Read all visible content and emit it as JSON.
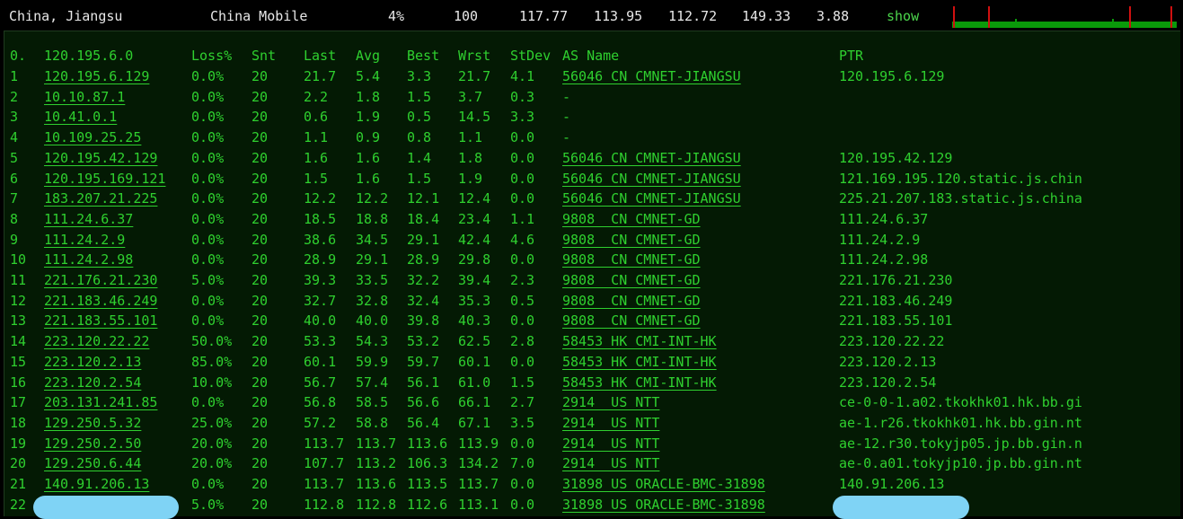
{
  "summary": {
    "location": "China, Jiangsu",
    "provider": "China Mobile",
    "loss": "4%",
    "sent": "100",
    "last": "117.77",
    "avg": "113.95",
    "best": "112.72",
    "worst": "149.33",
    "stdev": "3.88",
    "show_label": "show"
  },
  "colors": {
    "text_green": "#2fd02f",
    "panel_bg": "#041a04",
    "spark_green": "#0a9a0a",
    "spark_red": "#d01010",
    "redact_blue": "#7fd3f5"
  },
  "headers": {
    "hop": "0.",
    "host": "120.195.6.0",
    "loss": "Loss%",
    "snt": "Snt",
    "last": "Last",
    "avg": "Avg",
    "best": "Best",
    "wrst": "Wrst",
    "stdev": "StDev",
    "asname": "AS Name",
    "ptr": "PTR"
  },
  "hops": [
    {
      "hop": "1",
      "host": "120.195.6.129",
      "loss": "0.0%",
      "snt": "20",
      "last": "21.7",
      "avg": "5.4",
      "best": "3.3",
      "wrst": "21.7",
      "stdev": "4.1",
      "asname": "56046 CN CMNET-JIANGSU",
      "ptr": "120.195.6.129"
    },
    {
      "hop": "2",
      "host": "10.10.87.1",
      "loss": "0.0%",
      "snt": "20",
      "last": "2.2",
      "avg": "1.8",
      "best": "1.5",
      "wrst": "3.7",
      "stdev": "0.3",
      "asname": "-",
      "ptr": ""
    },
    {
      "hop": "3",
      "host": "10.41.0.1",
      "loss": "0.0%",
      "snt": "20",
      "last": "0.6",
      "avg": "1.9",
      "best": "0.5",
      "wrst": "14.5",
      "stdev": "3.3",
      "asname": "-",
      "ptr": ""
    },
    {
      "hop": "4",
      "host": "10.109.25.25",
      "loss": "0.0%",
      "snt": "20",
      "last": "1.1",
      "avg": "0.9",
      "best": "0.8",
      "wrst": "1.1",
      "stdev": "0.0",
      "asname": "-",
      "ptr": ""
    },
    {
      "hop": "5",
      "host": "120.195.42.129",
      "loss": "0.0%",
      "snt": "20",
      "last": "1.6",
      "avg": "1.6",
      "best": "1.4",
      "wrst": "1.8",
      "stdev": "0.0",
      "asname": "56046 CN CMNET-JIANGSU",
      "ptr": "120.195.42.129"
    },
    {
      "hop": "6",
      "host": "120.195.169.121",
      "loss": "0.0%",
      "snt": "20",
      "last": "1.5",
      "avg": "1.6",
      "best": "1.5",
      "wrst": "1.9",
      "stdev": "0.0",
      "asname": "56046 CN CMNET-JIANGSU",
      "ptr": "121.169.195.120.static.js.chin"
    },
    {
      "hop": "7",
      "host": "183.207.21.225",
      "loss": "0.0%",
      "snt": "20",
      "last": "12.2",
      "avg": "12.2",
      "best": "12.1",
      "wrst": "12.4",
      "stdev": "0.0",
      "asname": "56046 CN CMNET-JIANGSU",
      "ptr": "225.21.207.183.static.js.china"
    },
    {
      "hop": "8",
      "host": "111.24.6.37",
      "loss": "0.0%",
      "snt": "20",
      "last": "18.5",
      "avg": "18.8",
      "best": "18.4",
      "wrst": "23.4",
      "stdev": "1.1",
      "asname": "9808  CN CMNET-GD",
      "ptr": "111.24.6.37"
    },
    {
      "hop": "9",
      "host": "111.24.2.9",
      "loss": "0.0%",
      "snt": "20",
      "last": "38.6",
      "avg": "34.5",
      "best": "29.1",
      "wrst": "42.4",
      "stdev": "4.6",
      "asname": "9808  CN CMNET-GD",
      "ptr": "111.24.2.9"
    },
    {
      "hop": "10",
      "host": "111.24.2.98",
      "loss": "0.0%",
      "snt": "20",
      "last": "28.9",
      "avg": "29.1",
      "best": "28.9",
      "wrst": "29.8",
      "stdev": "0.0",
      "asname": "9808  CN CMNET-GD",
      "ptr": "111.24.2.98"
    },
    {
      "hop": "11",
      "host": "221.176.21.230",
      "loss": "5.0%",
      "snt": "20",
      "last": "39.3",
      "avg": "33.5",
      "best": "32.2",
      "wrst": "39.4",
      "stdev": "2.3",
      "asname": "9808  CN CMNET-GD",
      "ptr": "221.176.21.230"
    },
    {
      "hop": "12",
      "host": "221.183.46.249",
      "loss": "0.0%",
      "snt": "20",
      "last": "32.7",
      "avg": "32.8",
      "best": "32.4",
      "wrst": "35.3",
      "stdev": "0.5",
      "asname": "9808  CN CMNET-GD",
      "ptr": "221.183.46.249"
    },
    {
      "hop": "13",
      "host": "221.183.55.101",
      "loss": "0.0%",
      "snt": "20",
      "last": "40.0",
      "avg": "40.0",
      "best": "39.8",
      "wrst": "40.3",
      "stdev": "0.0",
      "asname": "9808  CN CMNET-GD",
      "ptr": "221.183.55.101"
    },
    {
      "hop": "14",
      "host": "223.120.22.22",
      "loss": "50.0%",
      "snt": "20",
      "last": "53.3",
      "avg": "54.3",
      "best": "53.2",
      "wrst": "62.5",
      "stdev": "2.8",
      "asname": "58453 HK CMI-INT-HK",
      "ptr": "223.120.22.22"
    },
    {
      "hop": "15",
      "host": "223.120.2.13",
      "loss": "85.0%",
      "snt": "20",
      "last": "60.1",
      "avg": "59.9",
      "best": "59.7",
      "wrst": "60.1",
      "stdev": "0.0",
      "asname": "58453 HK CMI-INT-HK",
      "ptr": "223.120.2.13"
    },
    {
      "hop": "16",
      "host": "223.120.2.54",
      "loss": "10.0%",
      "snt": "20",
      "last": "56.7",
      "avg": "57.4",
      "best": "56.1",
      "wrst": "61.0",
      "stdev": "1.5",
      "asname": "58453 HK CMI-INT-HK",
      "ptr": "223.120.2.54"
    },
    {
      "hop": "17",
      "host": "203.131.241.85",
      "loss": "0.0%",
      "snt": "20",
      "last": "56.8",
      "avg": "58.5",
      "best": "56.6",
      "wrst": "66.1",
      "stdev": "2.7",
      "asname": "2914  US NTT",
      "ptr": "ce-0-0-1.a02.tkokhk01.hk.bb.gi"
    },
    {
      "hop": "18",
      "host": "129.250.5.32",
      "loss": "25.0%",
      "snt": "20",
      "last": "57.2",
      "avg": "58.8",
      "best": "56.4",
      "wrst": "67.1",
      "stdev": "3.5",
      "asname": "2914  US NTT",
      "ptr": "ae-1.r26.tkokhk01.hk.bb.gin.nt"
    },
    {
      "hop": "19",
      "host": "129.250.2.50",
      "loss": "20.0%",
      "snt": "20",
      "last": "113.7",
      "avg": "113.7",
      "best": "113.6",
      "wrst": "113.9",
      "stdev": "0.0",
      "asname": "2914  US NTT",
      "ptr": "ae-12.r30.tokyjp05.jp.bb.gin.n"
    },
    {
      "hop": "20",
      "host": "129.250.6.44",
      "loss": "20.0%",
      "snt": "20",
      "last": "107.7",
      "avg": "113.2",
      "best": "106.3",
      "wrst": "134.2",
      "stdev": "7.0",
      "asname": "2914  US NTT",
      "ptr": "ae-0.a01.tokyjp10.jp.bb.gin.nt"
    },
    {
      "hop": "21",
      "host": "140.91.206.13",
      "loss": "0.0%",
      "snt": "20",
      "last": "113.7",
      "avg": "113.6",
      "best": "113.5",
      "wrst": "113.7",
      "stdev": "0.0",
      "asname": "31898 US ORACLE-BMC-31898",
      "ptr": "140.91.206.13"
    },
    {
      "hop": "22",
      "host": "",
      "loss": "5.0%",
      "snt": "20",
      "last": "112.8",
      "avg": "112.8",
      "best": "112.6",
      "wrst": "113.1",
      "stdev": "0.0",
      "asname": "31898 US ORACLE-BMC-31898",
      "ptr": ""
    }
  ]
}
